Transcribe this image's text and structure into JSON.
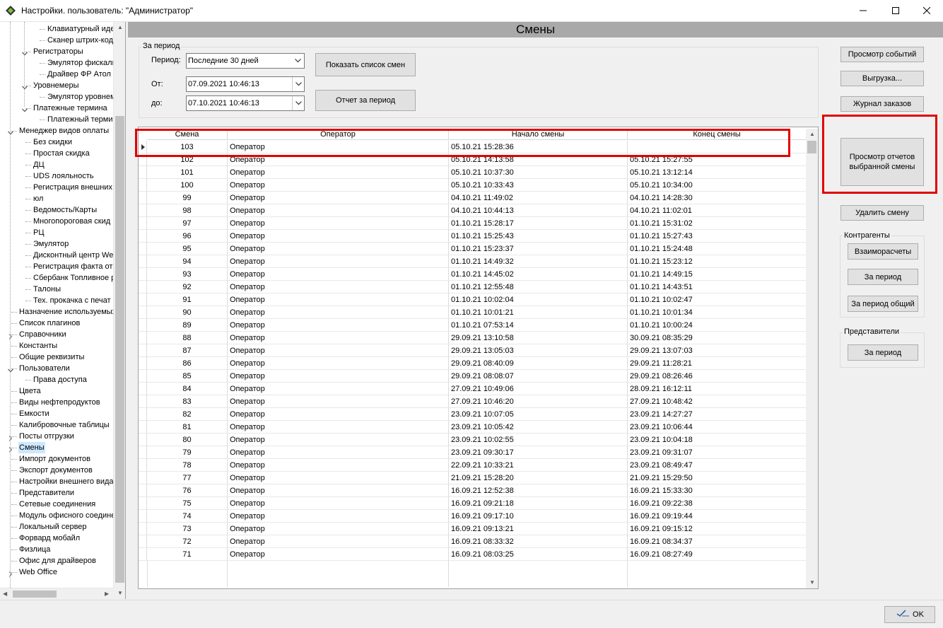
{
  "window": {
    "title": "Настройки. пользователь: \"Администратор\"",
    "icons": [
      "app-logo-icon",
      "minimize-icon",
      "maximize-icon",
      "close-icon"
    ]
  },
  "tree": {
    "items": [
      {
        "label": "Клавиатурный иде"
      },
      {
        "label": "Сканер штрих-код"
      },
      {
        "label": "Регистраторы"
      },
      {
        "label": "Эмулятор фискаль"
      },
      {
        "label": "Драйвер ФР Атол"
      },
      {
        "label": "Уровнемеры"
      },
      {
        "label": "Эмулятор уровнем"
      },
      {
        "label": "Платежные термина"
      },
      {
        "label": "Платежный терми"
      },
      {
        "label": "Менеджер видов оплаты"
      },
      {
        "label": "Без скидки"
      },
      {
        "label": "Простая скидка"
      },
      {
        "label": "ДЦ"
      },
      {
        "label": "UDS лояльность"
      },
      {
        "label": "Регистрация внешних"
      },
      {
        "label": "юл"
      },
      {
        "label": "Ведомость/Карты"
      },
      {
        "label": "Многопороговая скид"
      },
      {
        "label": "РЦ"
      },
      {
        "label": "Эмулятор"
      },
      {
        "label": "Дисконтный центр We"
      },
      {
        "label": "Регистрация факта от"
      },
      {
        "label": "Сбербанк Топливное р"
      },
      {
        "label": "Талоны"
      },
      {
        "label": "Тех. прокачка с печат"
      },
      {
        "label": "Назначение используемых"
      },
      {
        "label": "Список плагинов"
      },
      {
        "label": "Справочники"
      },
      {
        "label": "Константы"
      },
      {
        "label": "Общие реквизиты"
      },
      {
        "label": "Пользователи"
      },
      {
        "label": "Права доступа"
      },
      {
        "label": "Цвета"
      },
      {
        "label": "Виды нефтепродуктов"
      },
      {
        "label": "Емкости"
      },
      {
        "label": "Калибровочные таблицы"
      },
      {
        "label": "Посты отгрузки"
      },
      {
        "label": "Смены"
      },
      {
        "label": "Импорт документов"
      },
      {
        "label": "Экспорт документов"
      },
      {
        "label": "Настройки внешнего вида"
      },
      {
        "label": "Представители"
      },
      {
        "label": "Сетевые соединения"
      },
      {
        "label": "Модуль офисного соедине"
      },
      {
        "label": "Локальный сервер"
      },
      {
        "label": "Форвард мобайл"
      },
      {
        "label": "Физлица"
      },
      {
        "label": "Офис для драйверов"
      },
      {
        "label": "Web Office"
      }
    ]
  },
  "main": {
    "title": "Смены",
    "period_group": {
      "title": "За период",
      "period_label": "Период:",
      "period_value": "Последние 30 дней",
      "from_label": "От:",
      "from_value": "07.09.2021 10:46:13",
      "to_label": "до:",
      "to_value": "07.10.2021 10:46:13",
      "show_list_button": "Показать список смен",
      "period_report_button": "Отчет за период"
    },
    "grid": {
      "columns": [
        "Смена",
        "Оператор",
        "Начало смены",
        "Конец смены"
      ],
      "rows": [
        [
          "103",
          "Оператор",
          "05.10.21 15:28:36",
          ""
        ],
        [
          "102",
          "Оператор",
          "05.10.21 14:13:58",
          "05.10.21 15:27:55"
        ],
        [
          "101",
          "Оператор",
          "05.10.21 10:37:30",
          "05.10.21 13:12:14"
        ],
        [
          "100",
          "Оператор",
          "05.10.21 10:33:43",
          "05.10.21 10:34:00"
        ],
        [
          "99",
          "Оператор",
          "04.10.21 11:49:02",
          "04.10.21 14:28:30"
        ],
        [
          "98",
          "Оператор",
          "04.10.21 10:44:13",
          "04.10.21 11:02:01"
        ],
        [
          "97",
          "Оператор",
          "01.10.21 15:28:17",
          "01.10.21 15:31:02"
        ],
        [
          "96",
          "Оператор",
          "01.10.21 15:25:43",
          "01.10.21 15:27:43"
        ],
        [
          "95",
          "Оператор",
          "01.10.21 15:23:37",
          "01.10.21 15:24:48"
        ],
        [
          "94",
          "Оператор",
          "01.10.21 14:49:32",
          "01.10.21 15:23:12"
        ],
        [
          "93",
          "Оператор",
          "01.10.21 14:45:02",
          "01.10.21 14:49:15"
        ],
        [
          "92",
          "Оператор",
          "01.10.21 12:55:48",
          "01.10.21 14:43:51"
        ],
        [
          "91",
          "Оператор",
          "01.10.21 10:02:04",
          "01.10.21 10:02:47"
        ],
        [
          "90",
          "Оператор",
          "01.10.21 10:01:21",
          "01.10.21 10:01:34"
        ],
        [
          "89",
          "Оператор",
          "01.10.21 07:53:14",
          "01.10.21 10:00:24"
        ],
        [
          "88",
          "Оператор",
          "29.09.21 13:10:58",
          "30.09.21 08:35:29"
        ],
        [
          "87",
          "Оператор",
          "29.09.21 13:05:03",
          "29.09.21 13:07:03"
        ],
        [
          "86",
          "Оператор",
          "29.09.21 08:40:09",
          "29.09.21 11:28:21"
        ],
        [
          "85",
          "Оператор",
          "29.09.21 08:08:07",
          "29.09.21 08:26:46"
        ],
        [
          "84",
          "Оператор",
          "27.09.21 10:49:06",
          "28.09.21 16:12:11"
        ],
        [
          "83",
          "Оператор",
          "27.09.21 10:46:20",
          "27.09.21 10:48:42"
        ],
        [
          "82",
          "Оператор",
          "23.09.21 10:07:05",
          "23.09.21 14:27:27"
        ],
        [
          "81",
          "Оператор",
          "23.09.21 10:05:42",
          "23.09.21 10:06:44"
        ],
        [
          "80",
          "Оператор",
          "23.09.21 10:02:55",
          "23.09.21 10:04:18"
        ],
        [
          "79",
          "Оператор",
          "23.09.21 09:30:17",
          "23.09.21 09:31:07"
        ],
        [
          "78",
          "Оператор",
          "22.09.21 10:33:21",
          "23.09.21 08:49:47"
        ],
        [
          "77",
          "Оператор",
          "21.09.21 15:28:20",
          "21.09.21 15:29:50"
        ],
        [
          "76",
          "Оператор",
          "16.09.21 12:52:38",
          "16.09.21 15:33:30"
        ],
        [
          "75",
          "Оператор",
          "16.09.21 09:21:18",
          "16.09.21 09:22:38"
        ],
        [
          "74",
          "Оператор",
          "16.09.21 09:17:10",
          "16.09.21 09:19:44"
        ],
        [
          "73",
          "Оператор",
          "16.09.21 09:13:21",
          "16.09.21 09:15:12"
        ],
        [
          "72",
          "Оператор",
          "16.09.21 08:33:32",
          "16.09.21 08:34:37"
        ],
        [
          "71",
          "Оператор",
          "16.09.21 08:03:25",
          "16.09.21 08:27:49"
        ]
      ]
    },
    "right_panel": {
      "view_events": "Просмотр событий",
      "export": "Выгрузка...",
      "orders_log": "Журнал заказов",
      "view_reports": "Просмотр отчетов выбранной смены",
      "delete_shift": "Удалить смену",
      "contractors_title": "Контрагенты",
      "settlements": "Взаиморасчеты",
      "for_period": "За период",
      "for_period_total": "За период общий",
      "representatives_title": "Представители",
      "rep_for_period": "За период"
    }
  },
  "footer": {
    "ok_label": "OK"
  },
  "colors": {
    "highlight_red": "#e00000",
    "header_gray": "#a9a9a9",
    "selection_blue": "#cce8ff"
  }
}
